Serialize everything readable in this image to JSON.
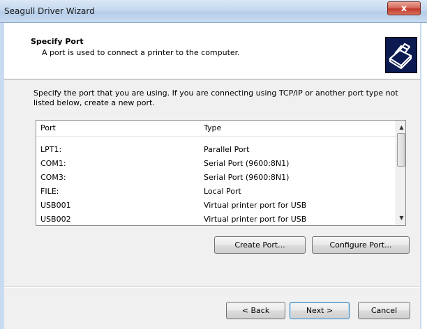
{
  "window": {
    "title": "Seagull Driver Wizard",
    "close_glyph": "x"
  },
  "header": {
    "title": "Specify Port",
    "subtitle": "A port is used to connect a printer to the computer.",
    "icon": "printer-icon"
  },
  "description": "Specify the port that you are using.  If you are connecting using TCP/IP or another port type not listed below, create a new port.",
  "port_list": {
    "columns": [
      "Port",
      "Type"
    ],
    "rows": [
      {
        "port": "LPT1:",
        "type": "Parallel Port"
      },
      {
        "port": "COM1:",
        "type": "Serial Port (9600:8N1)"
      },
      {
        "port": "COM3:",
        "type": "Serial Port (9600:8N1)"
      },
      {
        "port": "FILE:",
        "type": "Local Port"
      },
      {
        "port": "USB001",
        "type": "Virtual printer port for USB"
      },
      {
        "port": "USB002",
        "type": "Virtual printer port for USB"
      }
    ]
  },
  "port_buttons": {
    "create": "Create Port...",
    "configure": "Configure Port..."
  },
  "nav_buttons": {
    "back": "< Back",
    "next": "Next >",
    "cancel": "Cancel"
  }
}
